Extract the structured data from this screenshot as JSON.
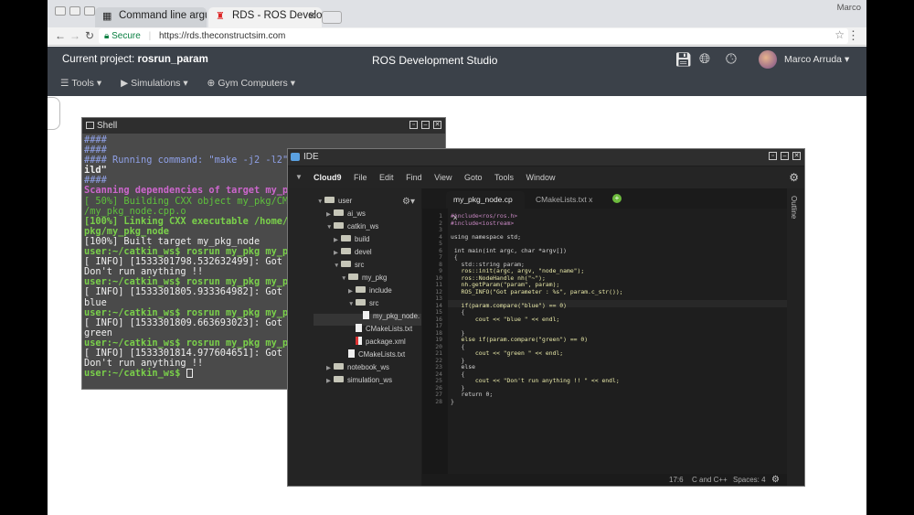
{
  "browser": {
    "window_user": "Marco",
    "tabs": [
      {
        "label": "Command line argu",
        "icon": "grid-icon"
      },
      {
        "label": "RDS - ROS Develop",
        "icon": "rds-icon"
      }
    ],
    "secure_label": "Secure",
    "url": "https://rds.theconstructsim.com"
  },
  "rds": {
    "project_prefix": "Current project:",
    "project_name": "rosrun_param",
    "title": "ROS Development Studio",
    "user_name": "Marco Arruda",
    "menu": [
      {
        "label": "Tools",
        "icon": "list-icon"
      },
      {
        "label": "Simulations",
        "icon": "play-icon"
      },
      {
        "label": "Gym Computers",
        "icon": "gamepad-icon"
      }
    ],
    "header_icons": [
      "save-icon",
      "globe-icon",
      "clock-icon"
    ]
  },
  "shell": {
    "title": "Shell",
    "lines": [
      "####",
      "####",
      "#### Running command: \"make -j2 -l2\"",
      "ild\"",
      "####",
      "Scanning dependencies of target my_pkg",
      "[ 50%] Building CXX object my_pkg/CMa",
      "/my_pkg_node.cpp.o",
      "[100%] Linking CXX executable /home/u",
      "pkg/my_pkg_node",
      "[100%] Built target my_pkg_node",
      "user:~/catkin_ws$ rosrun my_pkg my_pk",
      "[ INFO] [1533301798.532632499]: Got pa",
      "Don't run anything !!",
      "user:~/catkin_ws$ rosrun my_pkg my_pk",
      "[ INFO] [1533301805.933364982]: Got pa",
      "blue",
      "user:~/catkin_ws$ rosrun my_pkg my_pk",
      "[ INFO] [1533301809.663693023]: Got pa",
      "green",
      "user:~/catkin_ws$ rosrun my_pkg my_pk",
      "[ INFO] [1533301814.977604651]: Got pa",
      "Don't run anything !!",
      "user:~/catkin_ws$ "
    ]
  },
  "ide": {
    "title": "IDE",
    "menu": [
      "Cloud9",
      "File",
      "Edit",
      "Find",
      "View",
      "Goto",
      "Tools",
      "Window"
    ],
    "tree": [
      {
        "label": "user",
        "type": "folder"
      },
      {
        "label": "ai_ws",
        "type": "folder"
      },
      {
        "label": "catkin_ws",
        "type": "folder"
      },
      {
        "label": "build",
        "type": "folder"
      },
      {
        "label": "devel",
        "type": "folder"
      },
      {
        "label": "src",
        "type": "folder"
      },
      {
        "label": "my_pkg",
        "type": "folder"
      },
      {
        "label": "include",
        "type": "folder"
      },
      {
        "label": "src",
        "type": "folder"
      },
      {
        "label": "my_pkg_node.",
        "type": "file"
      },
      {
        "label": "CMakeLists.txt",
        "type": "file"
      },
      {
        "label": "package.xml",
        "type": "file"
      },
      {
        "label": "CMakeLists.txt",
        "type": "file"
      },
      {
        "label": "notebook_ws",
        "type": "folder"
      },
      {
        "label": "simulation_ws",
        "type": "folder"
      }
    ],
    "tabs": [
      {
        "label": "my_pkg_node.cp",
        "close": "x"
      },
      {
        "label": "CMakeLists.txt",
        "close": "x"
      }
    ],
    "code": [
      "#include<ros/ros.h>",
      "#include<iostream>",
      "",
      "using namespace std;",
      "",
      " int main(int argc, char *argv[])",
      " {",
      "   std::string param;",
      "   ros::init(argc, argv, \"node_name\");",
      "   ros::NodeHandle nh(\"~\");",
      "   nh.getParam(\"param\", param);",
      "   ROS_INFO(\"Got parameter : %s\", param.c_str());",
      "",
      "   if(param.compare(\"blue\") == 0)",
      "   {",
      "       cout << \"blue \" << endl;",
      "",
      "   }",
      "   else if(param.compare(\"green\") == 0)",
      "   {",
      "       cout << \"green \" << endl;",
      "   }",
      "   else",
      "   {",
      "       cout << \"Don't run anything !! \" << endl;",
      "   }",
      "   return 0;",
      "}"
    ],
    "status": {
      "position": "17:6",
      "language": "C and C++",
      "spaces": "Spaces: 4"
    },
    "outline_label": "Outline"
  }
}
